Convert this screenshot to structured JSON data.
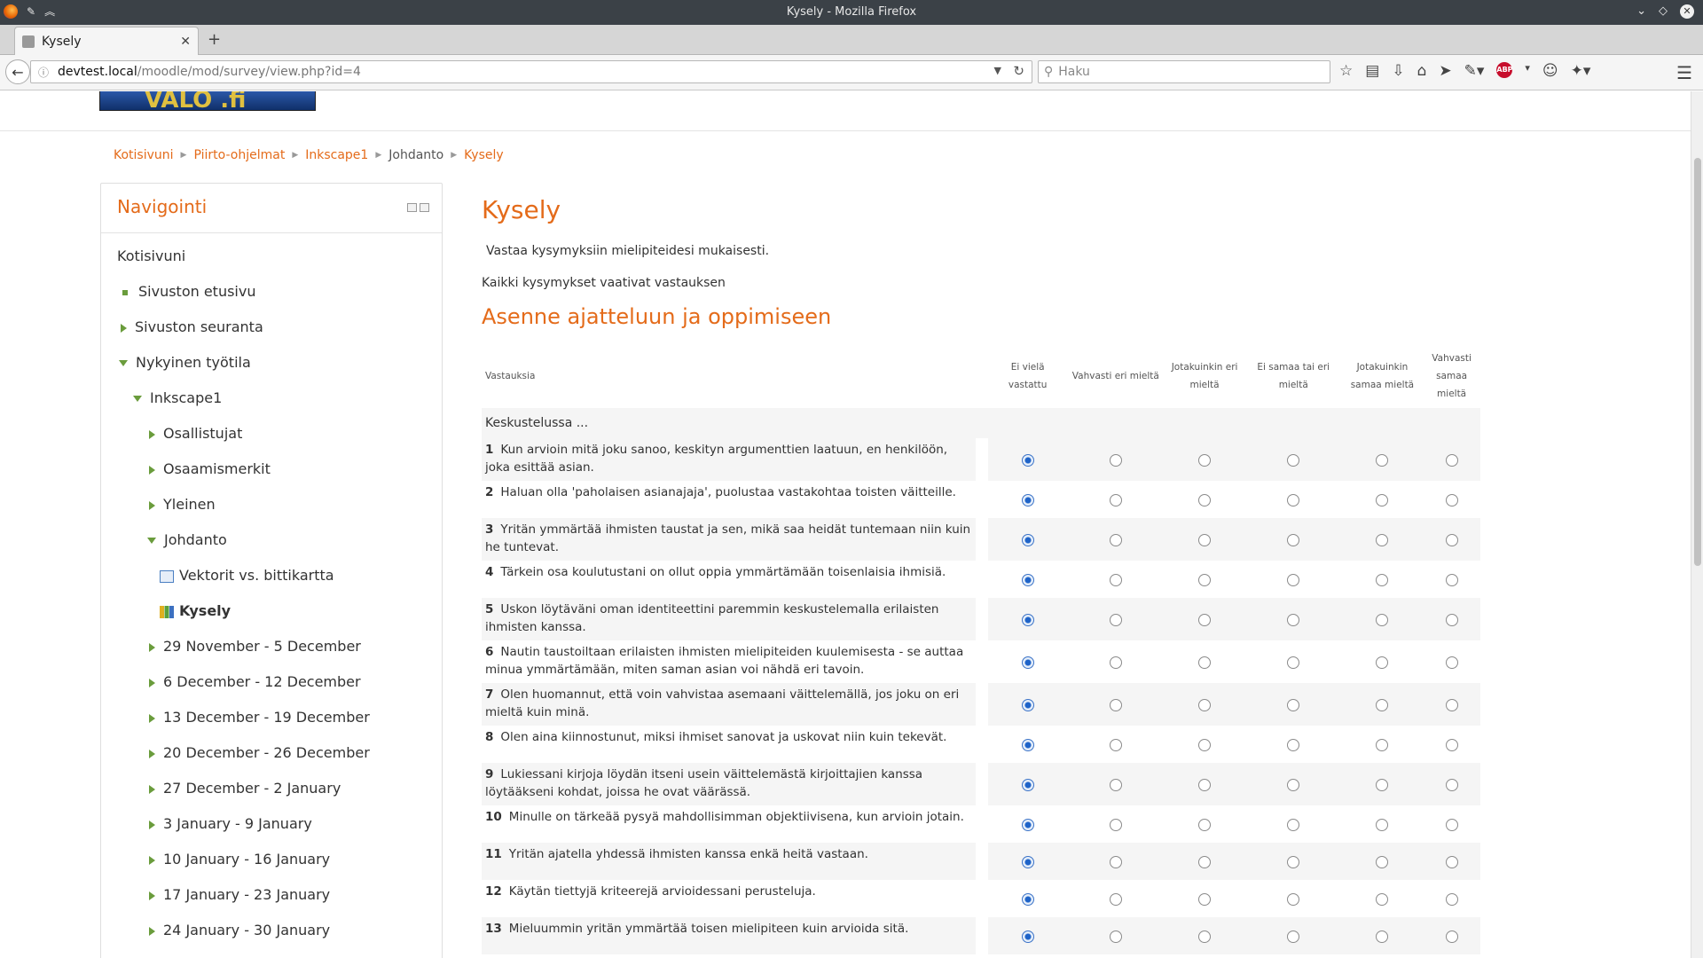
{
  "browser": {
    "window_title": "Kysely - Mozilla Firefox",
    "tab_title": "Kysely",
    "url_host": "devtest.local",
    "url_path": "/moodle/mod/survey/view.php?id=4",
    "search_placeholder": "Haku"
  },
  "breadcrumb": {
    "items": [
      "Kotisivuni",
      "Piirto-ohjelmat",
      "Inkscape1",
      "Johdanto",
      "Kysely"
    ]
  },
  "nav": {
    "heading": "Navigointi",
    "items": [
      "Kotisivuni",
      "Sivuston etusivu",
      "Sivuston seuranta",
      "Nykyinen työtila",
      "Inkscape1",
      "Osallistujat",
      "Osaamismerkit",
      "Yleinen",
      "Johdanto",
      "Vektorit vs. bittikartta",
      "Kysely",
      "29 November - 5 December",
      "6 December - 12 December",
      "13 December - 19 December",
      "20 December - 26 December",
      "27 December - 2 January",
      "3 January - 9 January",
      "10 January - 16 January",
      "17 January - 23 January",
      "24 January - 30 January"
    ]
  },
  "main": {
    "title": "Kysely",
    "intro": "Vastaa kysymyksiin mielipiteidesi mukaisesti.",
    "required_note": "Kaikki kysymykset vaativat vastauksen",
    "section_title": "Asenne ajatteluun ja oppimiseen",
    "table": {
      "header_question": "Vastauksia",
      "options": [
        "Ei vielä vastattu",
        "Vahvasti eri mieltä",
        "Jotakuinkin eri mieltä",
        "Ei samaa tai eri mieltä",
        "Jotakuinkin samaa mieltä",
        "Vahvasti samaa mieltä"
      ],
      "section_row": "Keskustelussa ...",
      "questions": [
        {
          "n": "1",
          "text": "Kun arvioin mitä joku sanoo, keskityn argumenttien laatuun, en henkilöön, joka esittää asian."
        },
        {
          "n": "2",
          "text": "Haluan olla 'paholaisen asianajaja', puolustaa vastakohtaa toisten väitteille."
        },
        {
          "n": "3",
          "text": "Yritän ymmärtää ihmisten taustat ja sen, mikä saa heidät tuntemaan niin kuin he tuntevat."
        },
        {
          "n": "4",
          "text": "Tärkein osa koulutustani on ollut oppia ymmärtämään toisenlaisia ihmisiä."
        },
        {
          "n": "5",
          "text": "Uskon löytäväni oman identiteettini paremmin keskustelemalla erilaisten ihmisten kanssa."
        },
        {
          "n": "6",
          "text": "Nautin taustoiltaan erilaisten ihmisten mielipiteiden kuulemisesta - se auttaa minua ymmärtämään, miten saman asian voi nähdä eri tavoin."
        },
        {
          "n": "7",
          "text": "Olen huomannut, että voin vahvistaa asemaani väittelemällä, jos joku on eri mieltä kuin minä."
        },
        {
          "n": "8",
          "text": "Olen aina kiinnostunut, miksi ihmiset sanovat ja uskovat niin kuin tekevät."
        },
        {
          "n": "9",
          "text": "Lukiessani kirjoja löydän itseni usein väittelemästä kirjoittajien kanssa löytääkseni kohdat, joissa he ovat väärässä."
        },
        {
          "n": "10",
          "text": "Minulle on tärkeää pysyä mahdollisimman objektiivisena, kun arvioin jotain."
        },
        {
          "n": "11",
          "text": "Yritän ajatella yhdessä ihmisten kanssa enkä heitä vastaan."
        },
        {
          "n": "12",
          "text": "Käytän tiettyjä kriteerejä arvioidessani perusteluja."
        },
        {
          "n": "13",
          "text": "Mieluummin yritän ymmärtää toisen mielipiteen kuin arvioida sitä."
        }
      ]
    }
  },
  "colors": {
    "accent": "#e46b1a",
    "radio_selected": "#1e63c8"
  }
}
